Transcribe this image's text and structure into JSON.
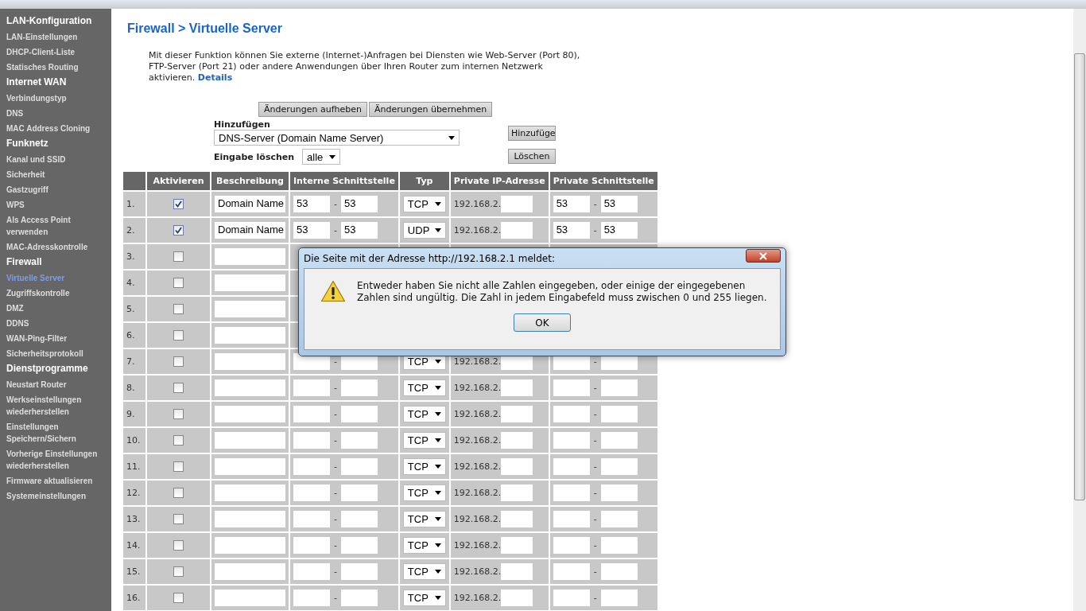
{
  "sidebar": {
    "sections": [
      {
        "heading": "LAN-Konfiguration",
        "items": [
          {
            "label": "LAN-Einstellungen",
            "selected": false
          },
          {
            "label": "DHCP-Client-Liste",
            "selected": false
          },
          {
            "label": "Statisches Routing",
            "selected": false
          }
        ]
      },
      {
        "heading": "Internet WAN",
        "items": [
          {
            "label": "Verbindungstyp",
            "selected": false
          },
          {
            "label": "DNS",
            "selected": false
          },
          {
            "label": "MAC Address Cloning",
            "selected": false
          }
        ]
      },
      {
        "heading": "Funknetz",
        "items": [
          {
            "label": "Kanal und SSID",
            "selected": false
          },
          {
            "label": "Sicherheit",
            "selected": false
          },
          {
            "label": "Gastzugriff",
            "selected": false
          },
          {
            "label": "WPS",
            "selected": false
          },
          {
            "label": "Als Access Point verwenden",
            "selected": false
          },
          {
            "label": "MAC-Adresskontrolle",
            "selected": false
          }
        ]
      },
      {
        "heading": "Firewall",
        "items": [
          {
            "label": "Virtuelle Server",
            "selected": true
          },
          {
            "label": "Zugriffskontrolle",
            "selected": false
          },
          {
            "label": "DMZ",
            "selected": false
          },
          {
            "label": "DDNS",
            "selected": false
          },
          {
            "label": "WAN-Ping-Filter",
            "selected": false
          },
          {
            "label": "Sicherheitsprotokoll",
            "selected": false
          }
        ]
      },
      {
        "heading": "Dienstprogramme",
        "items": [
          {
            "label": "Neustart Router",
            "selected": false
          },
          {
            "label": "Werkseinstellungen wiederherstellen",
            "selected": false
          },
          {
            "label": "Einstellungen Speichern/Sichern",
            "selected": false
          },
          {
            "label": "Vorherige Einstellungen wiederherstellen",
            "selected": false
          },
          {
            "label": "Firmware aktualisieren",
            "selected": false
          },
          {
            "label": "Systemeinstellungen",
            "selected": false
          }
        ]
      }
    ]
  },
  "page": {
    "title": "Firewall > Virtuelle Server",
    "intro": "Mit dieser Funktion können Sie externe (Internet-)Anfragen bei Diensten wie Web-Server (Port 80), FTP-Server (Port 21) oder andere Anwendungen über Ihren Router zum internen Netzwerk aktivieren.",
    "details_link": "Details",
    "buttons": [
      "Änderungen aufheben",
      "Änderungen übernehmen"
    ],
    "add": {
      "label": "Hinzufügen",
      "value": "DNS-Server (Domain Name Server)",
      "button": "Hinzufüge"
    },
    "clear": {
      "label": "Eingabe löschen",
      "value": "alle",
      "button": "Löschen"
    }
  },
  "table": {
    "columns": [
      "Aktivieren",
      "Beschreibung",
      "Interne Schnittstelle",
      "Typ",
      "Private IP-Adresse",
      "Private Schnittstelle"
    ],
    "rows": [
      {
        "number": "1.",
        "checked": true,
        "description": "Domain Name",
        "port_from": "53",
        "port_to": "53",
        "sep": "-",
        "type": "TCP",
        "ip_prefix": "192.168.2.",
        "private_from": "53",
        "private_to": "53",
        "private_sep": "-"
      },
      {
        "number": "2.",
        "checked": true,
        "description": "Domain Name",
        "port_from": "53",
        "port_to": "53",
        "sep": "-",
        "type": "UDP",
        "ip_prefix": "192.168.2.",
        "private_from": "53",
        "private_to": "53",
        "private_sep": "-"
      },
      {
        "number": "3.",
        "checked": false
      },
      {
        "number": "4.",
        "checked": false
      },
      {
        "number": "5.",
        "checked": false
      },
      {
        "number": "6.",
        "checked": false
      },
      {
        "number": "7.",
        "checked": false,
        "sep": "-",
        "type": "TCP",
        "ip_prefix": "192.168.2.",
        "private_sep": "-"
      },
      {
        "number": "8.",
        "checked": false,
        "sep": "-",
        "type": "TCP",
        "ip_prefix": "192.168.2.",
        "private_sep": "-"
      },
      {
        "number": "9.",
        "checked": false,
        "sep": "-",
        "type": "TCP",
        "ip_prefix": "192.168.2.",
        "private_sep": "-"
      },
      {
        "number": "10.",
        "checked": false,
        "sep": "-",
        "type": "TCP",
        "ip_prefix": "192.168.2.",
        "private_sep": "-"
      },
      {
        "number": "11.",
        "checked": false,
        "sep": "-",
        "type": "TCP",
        "ip_prefix": "192.168.2.",
        "private_sep": "-"
      },
      {
        "number": "12.",
        "checked": false,
        "sep": "-",
        "type": "TCP",
        "ip_prefix": "192.168.2.",
        "private_sep": "-"
      },
      {
        "number": "13.",
        "checked": false,
        "sep": "-",
        "type": "TCP",
        "ip_prefix": "192.168.2.",
        "private_sep": "-"
      },
      {
        "number": "14.",
        "checked": false,
        "sep": "-",
        "type": "TCP",
        "ip_prefix": "192.168.2.",
        "private_sep": "-"
      },
      {
        "number": "15.",
        "checked": false,
        "sep": "-",
        "type": "TCP",
        "ip_prefix": "192.168.2.",
        "private_sep": "-"
      },
      {
        "number": "16.",
        "checked": false,
        "sep": "-",
        "type": "TCP",
        "ip_prefix": "192.168.2.",
        "private_sep": "-"
      }
    ]
  },
  "dialog": {
    "title": "Die Seite mit der Adresse http://192.168.2.1 meldet:",
    "message": "Entweder haben Sie nicht alle Zahlen eingegeben, oder einige der eingegebenen Zahlen sind ungültig. Die Zahl in jedem Eingabefeld muss zwischen 0 und 255 liegen.",
    "button": "OK"
  }
}
